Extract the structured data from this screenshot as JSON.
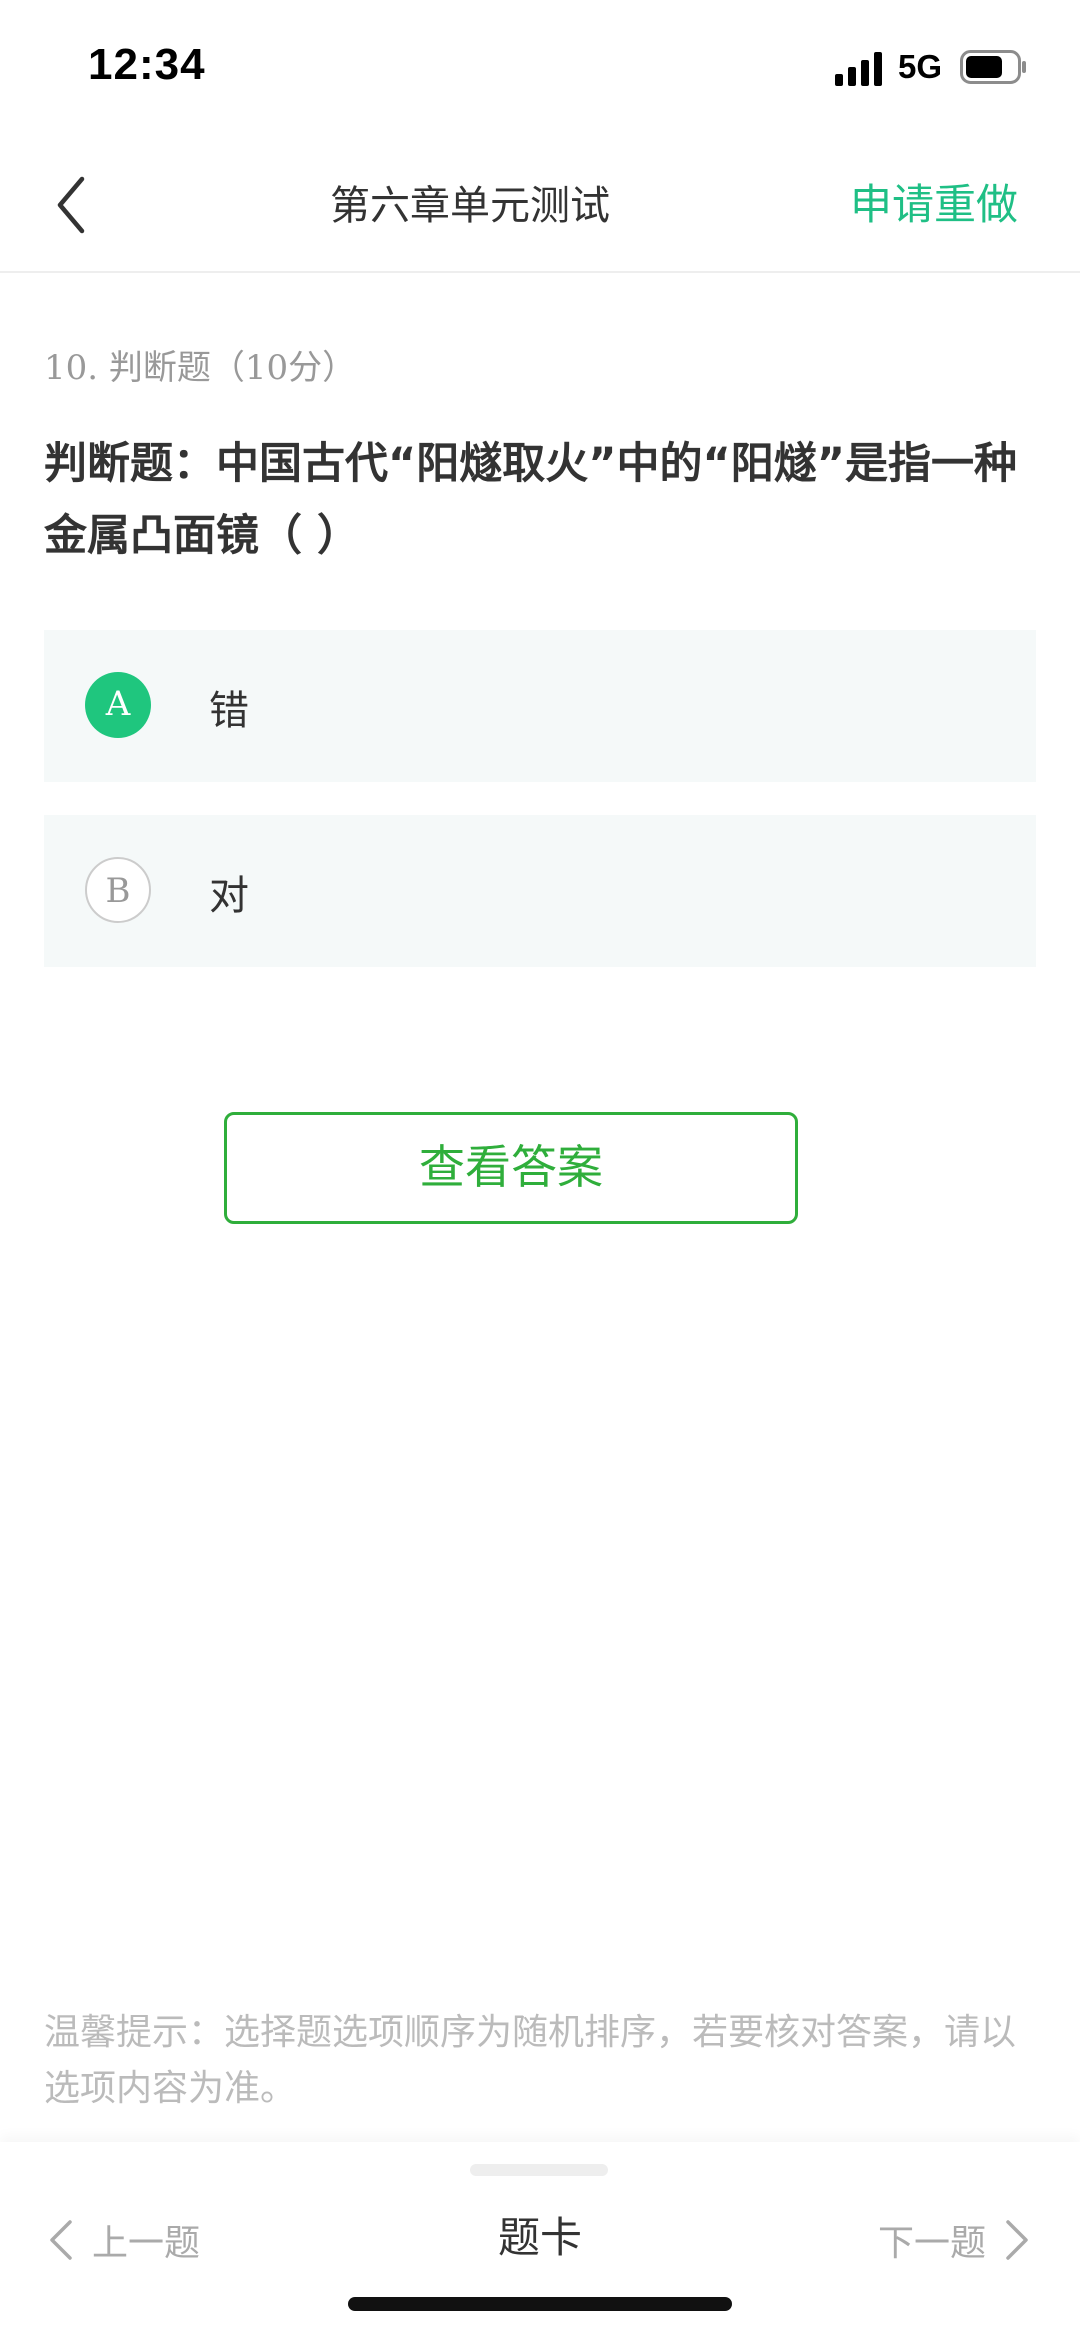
{
  "status_bar": {
    "time": "12:34",
    "network": "5G",
    "icons": [
      "signal-icon",
      "battery-icon"
    ]
  },
  "nav": {
    "title": "第六章单元测试",
    "redo_label": "申请重做",
    "back_icon": "chevron-left-icon"
  },
  "question": {
    "meta": "10. 判断题（10分）",
    "text": "判断题：中国古代“阳燧取火”中的“阳燧”是指一种金属凸面镜（ ）",
    "options": [
      {
        "marker": "A",
        "label": "错",
        "selected": true
      },
      {
        "marker": "B",
        "label": "对",
        "selected": false
      }
    ]
  },
  "view_answer_label": "查看答案",
  "tip": "温馨提示：选择题选项顺序为随机排序，若要核对答案，请以选项内容为准。",
  "bottom_bar": {
    "prev_label": "上一题",
    "card_label": "题卡",
    "next_label": "下一题"
  },
  "colors": {
    "accent_green": "#1fbf85",
    "selected_green": "#1fc67e",
    "button_green": "#2fae3b",
    "option_bg": "#f5f9f9"
  }
}
